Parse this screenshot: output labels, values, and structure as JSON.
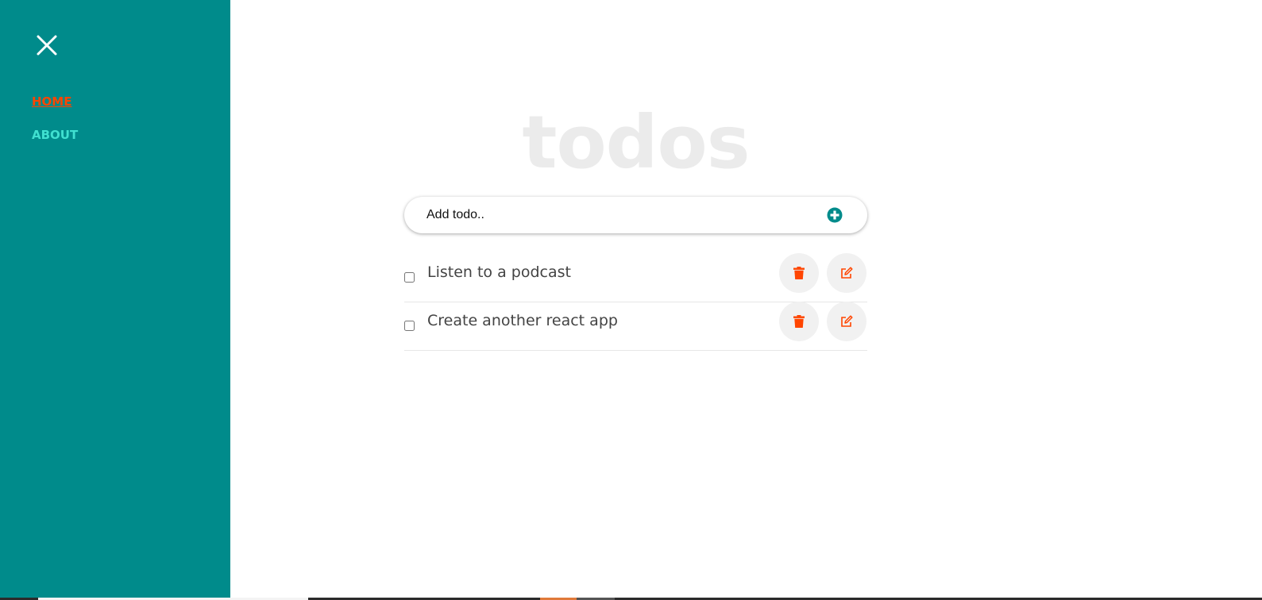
{
  "sidebar": {
    "close_icon": "close-icon",
    "nav": [
      {
        "label": "HOME",
        "active": true
      },
      {
        "label": "ABOUT",
        "active": false
      }
    ],
    "colors": {
      "background": "#008b8b",
      "active": "#ff4500",
      "inactive": "#40e0d0"
    }
  },
  "main": {
    "title": "todos",
    "add_form": {
      "placeholder": "Add todo..",
      "value": "",
      "add_icon": "plus-circle-icon"
    },
    "todos": [
      {
        "text": "Listen to a podcast",
        "completed": false
      },
      {
        "text": "Create another react app",
        "completed": false
      }
    ],
    "icons": {
      "delete": "trash-icon",
      "edit": "edit-icon"
    },
    "colors": {
      "title": "#ebebeb",
      "accent": "#ff4500",
      "add_icon": "#008b8b"
    }
  }
}
